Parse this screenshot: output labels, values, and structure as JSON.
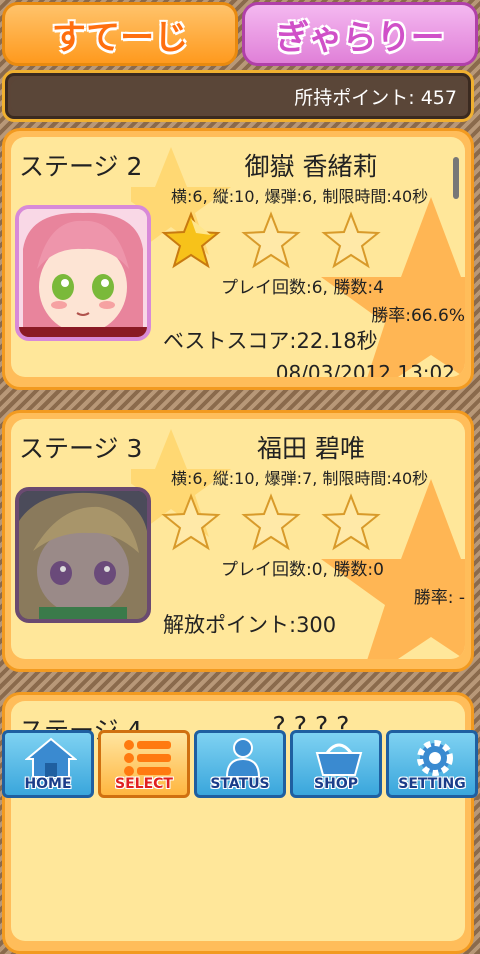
{
  "tabs": {
    "stage": "すてーじ",
    "gallery": "ぎゃらりー"
  },
  "points": {
    "text": "所持ポイント: 457"
  },
  "stages": [
    {
      "label": "ステージ 2",
      "name": "御嶽 香緒莉",
      "rules": "横:6, 縦:10, 爆弾:6, 制限時間:40秒",
      "stars_earned": 1,
      "stars_total": 3,
      "plays": "プレイ回数:6, 勝数:4",
      "winrate": "勝率:66.6%",
      "best": "ベストスコア:22.18秒",
      "date": "08/03/2012 13:02"
    },
    {
      "label": "ステージ 3",
      "name": "福田 碧唯",
      "rules": "横:6, 縦:10, 爆弾:7, 制限時間:40秒",
      "stars_earned": 0,
      "stars_total": 3,
      "plays": "プレイ回数:0, 勝数:0",
      "winrate": "勝率: -",
      "unlock": "解放ポイント:300"
    },
    {
      "label": "ステージ 4",
      "name": "? ? ? ?"
    }
  ],
  "nav": {
    "home": "HOME",
    "select": "SELECT",
    "status": "STATUS",
    "shop": "SHOP",
    "setting": "SETTING"
  },
  "colors": {
    "accent": "#ff9a1e",
    "card_bg": "#ffe79a",
    "star_gold": "#f2b20c",
    "nav_blue": "#3aa6dc"
  }
}
